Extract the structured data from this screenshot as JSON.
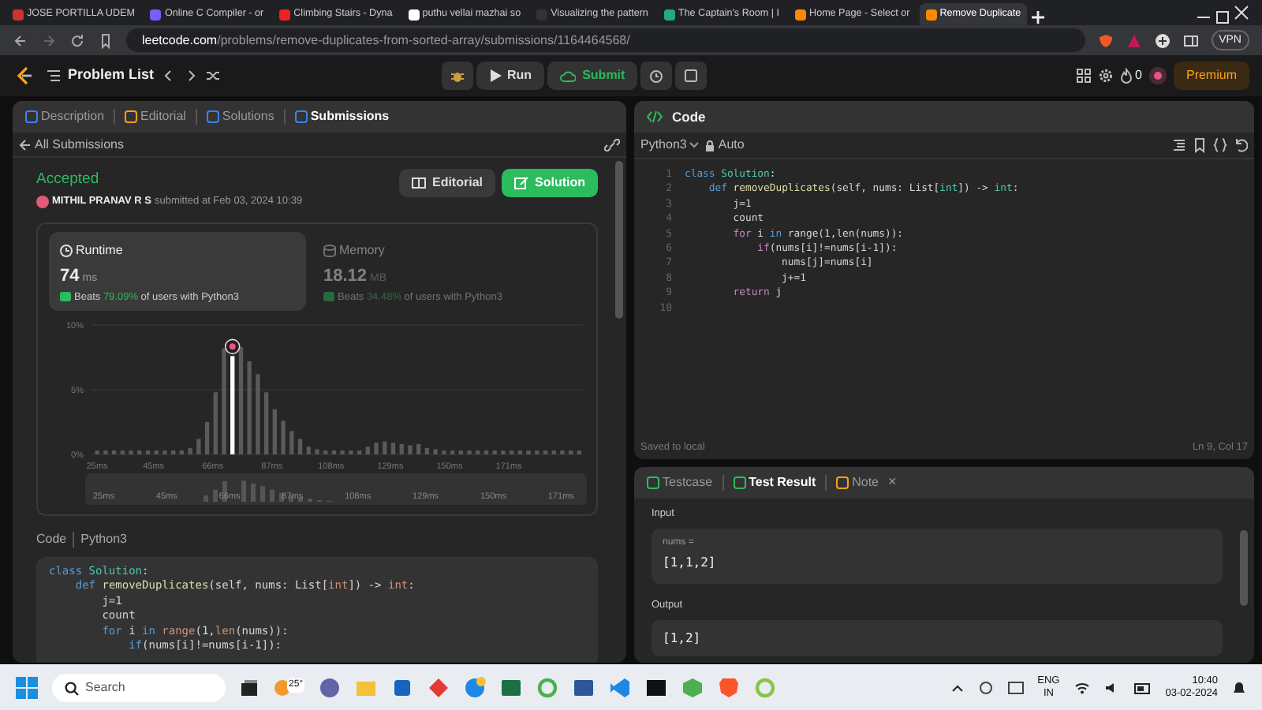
{
  "browser": {
    "tabs": [
      {
        "title": "JOSE PORTILLA UDEM",
        "selected": false
      },
      {
        "title": "Online C Compiler - or",
        "selected": false
      },
      {
        "title": "Climbing Stairs - Dyna",
        "selected": false
      },
      {
        "title": "puthu vellai mazhai so",
        "selected": false
      },
      {
        "title": "Visualizing the pattern",
        "selected": false
      },
      {
        "title": "The Captain's Room | I",
        "selected": false
      },
      {
        "title": "Home Page - Select or",
        "selected": false
      },
      {
        "title": "Remove Duplicate",
        "selected": true
      }
    ],
    "url_host": "leetcode.com",
    "url_path": "/problems/remove-duplicates-from-sorted-array/submissions/1164464568/",
    "vpn_label": "VPN"
  },
  "header": {
    "problem_list": "Problem List",
    "run": "Run",
    "submit": "Submit",
    "streak": "0",
    "premium": "Premium"
  },
  "left_panel": {
    "tabs": [
      {
        "label": "Description",
        "selected": false
      },
      {
        "label": "Editorial",
        "selected": false
      },
      {
        "label": "Solutions",
        "selected": false
      },
      {
        "label": "Submissions",
        "selected": true
      }
    ],
    "back_label": "All Submissions",
    "status": "Accepted",
    "user": "MITHIL PRANAV R S",
    "submitted": "submitted at Feb 03, 2024 10:39",
    "buttons": [
      {
        "label": "Editorial",
        "kind": "secondary"
      },
      {
        "label": "Solution",
        "kind": "primary"
      }
    ],
    "stats": [
      {
        "title": "Runtime",
        "value": "74",
        "unit": "ms",
        "beats_prefix": "Beats",
        "beats": "79.09%",
        "beats_suffix": "of users with Python3",
        "selected": true
      },
      {
        "title": "Memory",
        "value": "18.12",
        "unit": "MB",
        "beats_prefix": "Beats",
        "beats": "34.48%",
        "beats_suffix": "of users with Python3",
        "selected": false
      }
    ],
    "chart_data": {
      "type": "bar",
      "xlim": [
        23,
        197
      ],
      "ylim": [
        0,
        10
      ],
      "x": [
        25,
        28,
        31,
        34,
        37,
        40,
        43,
        46,
        49,
        52,
        55,
        58,
        61,
        64,
        67,
        70,
        73,
        76,
        79,
        82,
        85,
        88,
        91,
        94,
        97,
        100,
        103,
        106,
        109,
        112,
        115,
        118,
        121,
        124,
        127,
        130,
        133,
        136,
        139,
        142,
        145,
        148,
        151,
        154,
        157,
        160,
        163,
        166,
        169,
        172,
        175,
        178,
        181,
        184,
        187,
        190,
        193,
        196
      ],
      "series": [
        {
          "color": "#5a5a5a",
          "values": [
            0.3,
            0.3,
            0.3,
            0.3,
            0.3,
            0.3,
            0.3,
            0.3,
            0.3,
            0.3,
            0.3,
            0.5,
            1.2,
            2.5,
            4.8,
            8.2,
            null,
            8.3,
            7.2,
            6.2,
            4.8,
            3.5,
            2.6,
            1.8,
            1.2,
            0.6,
            0.4,
            0.3,
            0.3,
            0.3,
            0.3,
            0.3,
            0.6,
            0.9,
            1.0,
            0.9,
            0.8,
            0.7,
            0.8,
            0.5,
            0.4,
            0.3,
            0.3,
            0.3,
            0.3,
            0.3,
            0.3,
            0.3,
            0.3,
            0.3,
            0.3,
            0.3,
            0.3,
            0.3,
            0.3,
            0.3,
            0.3,
            0.3
          ]
        },
        {
          "color": "#ffffff",
          "values": [
            null,
            null,
            null,
            null,
            null,
            null,
            null,
            null,
            null,
            null,
            null,
            null,
            null,
            null,
            null,
            null,
            7.6,
            null,
            null,
            null,
            null,
            null,
            null,
            null,
            null,
            null,
            null,
            null,
            null,
            null,
            null,
            null,
            null,
            null,
            null,
            null,
            null,
            null,
            null,
            null,
            null,
            null,
            null,
            null,
            null,
            null,
            null,
            null,
            null,
            null,
            null,
            null,
            null,
            null,
            null,
            null,
            null,
            null
          ]
        }
      ],
      "xticks": [
        {
          "value": 25,
          "label": "25ms"
        },
        {
          "value": 45,
          "label": "45ms"
        },
        {
          "value": 66,
          "label": "66ms"
        },
        {
          "value": 87,
          "label": "87ms"
        },
        {
          "value": 108,
          "label": "108ms"
        },
        {
          "value": 129,
          "label": "129ms"
        },
        {
          "value": 150,
          "label": "150ms"
        },
        {
          "value": 171,
          "label": "171ms"
        }
      ],
      "yticks": [
        {
          "value": 0,
          "label": "0%"
        },
        {
          "value": 5,
          "label": "5%"
        },
        {
          "value": 10,
          "label": "10%"
        }
      ]
    },
    "overview_labels": [
      "25ms",
      "45ms",
      "66ms",
      "87ms",
      "108ms",
      "129ms",
      "150ms",
      "171ms"
    ],
    "code_label": "Code",
    "code_lang": "Python3",
    "code": [
      [
        {
          "kind": "k",
          "text": "class"
        },
        {
          "kind": "c",
          "text": " Solution"
        },
        {
          "kind": "p",
          "text": ":"
        }
      ],
      [
        {
          "kind": "k",
          "text": "    def"
        },
        {
          "kind": "f",
          "text": " removeDuplicates"
        },
        {
          "kind": "p",
          "text": "(self, nums: List["
        },
        {
          "kind": "b",
          "text": "int"
        },
        {
          "kind": "p",
          "text": "]) -> "
        },
        {
          "kind": "b",
          "text": "int"
        },
        {
          "kind": "p",
          "text": ":"
        }
      ],
      [
        {
          "kind": "p",
          "text": "        j=1"
        }
      ],
      [
        {
          "kind": "p",
          "text": "        count"
        }
      ],
      [
        {
          "kind": "k",
          "text": "        for"
        },
        {
          "kind": "p",
          "text": " i "
        },
        {
          "kind": "k",
          "text": "in"
        },
        {
          "kind": "b",
          "text": " range"
        },
        {
          "kind": "p",
          "text": "(1,"
        },
        {
          "kind": "b",
          "text": "len"
        },
        {
          "kind": "p",
          "text": "(nums)):"
        }
      ],
      [
        {
          "kind": "k",
          "text": "            if"
        },
        {
          "kind": "p",
          "text": "(nums[i]!=nums[i-1]):"
        }
      ]
    ]
  },
  "editor": {
    "title": "Code",
    "language": "Python3",
    "mode": "Auto",
    "lines": [
      {
        "no": "1",
        "code": [
          {
            "kind": "k",
            "text": "class"
          },
          {
            "kind": "c",
            "text": " Solution"
          },
          {
            "kind": "p",
            "text": ":"
          }
        ]
      },
      {
        "no": "2",
        "code": [
          {
            "kind": "k",
            "text": "    def"
          },
          {
            "kind": "f",
            "text": " removeDuplicates"
          },
          {
            "kind": "p",
            "text": "(self, nums: List["
          },
          {
            "kind": "c",
            "text": "int"
          },
          {
            "kind": "p",
            "text": "]) -> "
          },
          {
            "kind": "c",
            "text": "int"
          },
          {
            "kind": "p",
            "text": ":"
          }
        ]
      },
      {
        "no": "3",
        "code": [
          {
            "kind": "p",
            "text": "        j=1"
          }
        ]
      },
      {
        "no": "4",
        "code": [
          {
            "kind": "p",
            "text": "        count"
          }
        ]
      },
      {
        "no": "5",
        "code": [
          {
            "kind": "m",
            "text": "        for"
          },
          {
            "kind": "p",
            "text": " i "
          },
          {
            "kind": "k",
            "text": "in"
          },
          {
            "kind": "p",
            "text": " range(1,len(nums)):"
          }
        ]
      },
      {
        "no": "6",
        "code": [
          {
            "kind": "m",
            "text": "            if"
          },
          {
            "kind": "p",
            "text": "(nums[i]!=nums[i-1]):"
          }
        ]
      },
      {
        "no": "7",
        "code": [
          {
            "kind": "p",
            "text": "                nums[j]=nums[i]"
          }
        ]
      },
      {
        "no": "8",
        "code": [
          {
            "kind": "p",
            "text": "                j+=1"
          }
        ]
      },
      {
        "no": "9",
        "code": [
          {
            "kind": "m",
            "text": "        return"
          },
          {
            "kind": "p",
            "text": " j"
          }
        ]
      },
      {
        "no": "10"
      }
    ],
    "status_left": "Saved to local",
    "cursor": "Ln 9, Col 17"
  },
  "result_panel": {
    "tabs": [
      {
        "label": "Testcase",
        "selected": false
      },
      {
        "label": "Test Result",
        "selected": true
      },
      {
        "label": "Note",
        "selected": false
      }
    ],
    "close_glyph": "×",
    "input_label": "Input",
    "param_name": "nums =",
    "param_value": "[1,1,2]",
    "output_label": "Output",
    "output_value": "[1,2]"
  },
  "taskbar": {
    "search_placeholder": "Search",
    "weather": "25°",
    "lang": "ENG",
    "region": "IN",
    "time": "10:40",
    "date": "03-02-2024"
  }
}
